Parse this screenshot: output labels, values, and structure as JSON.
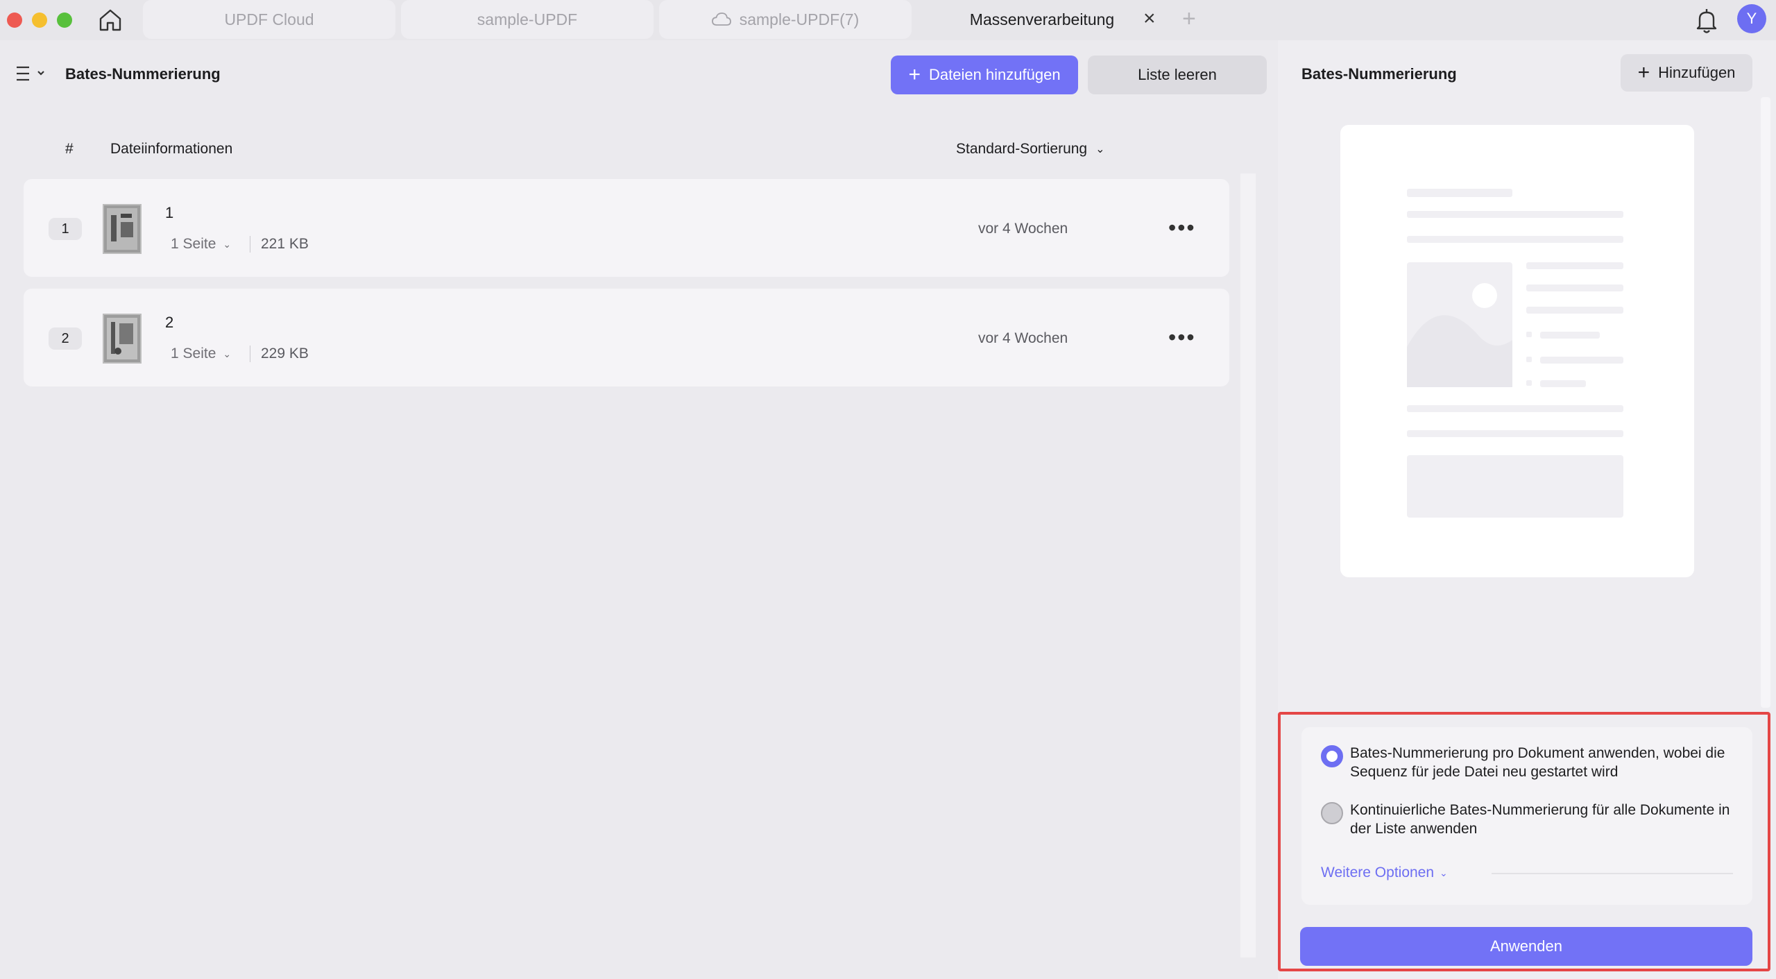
{
  "tabs": [
    {
      "label": "UPDF Cloud"
    },
    {
      "label": "sample-UPDF"
    },
    {
      "label": "sample-UPDF(7)"
    },
    {
      "label": "Massenverarbeitung"
    }
  ],
  "close_tab_symbol": "×",
  "new_tab_symbol": "+",
  "user": {
    "initial": "Y"
  },
  "left": {
    "title": "Bates-Nummerierung",
    "add_files_plus": "+",
    "add_files_label": "Dateien hinzufügen",
    "clear_list_label": "Liste leeren",
    "columns": {
      "hash": "#",
      "info": "Dateiinformationen"
    },
    "sort_label": "Standard-Sortierung",
    "files": [
      {
        "index": "1",
        "name": "1",
        "pages": "1 Seite",
        "size": "221 KB",
        "date": "vor 4 Wochen",
        "more": "•••"
      },
      {
        "index": "2",
        "name": "2",
        "pages": "1 Seite",
        "size": "229 KB",
        "date": "vor 4 Wochen",
        "more": "•••"
      }
    ]
  },
  "right": {
    "title": "Bates-Nummerierung",
    "add_plus": "+",
    "add_label": "Hinzufügen",
    "options": [
      {
        "text": "Bates-Nummerierung pro Dokument anwenden, wobei die Sequenz für jede Datei neu gestartet wird",
        "selected": true
      },
      {
        "text": "Kontinuierliche Bates-Nummerierung für alle Dokumente in der Liste anwenden",
        "selected": false
      }
    ],
    "more_options_label": "Weitere Optionen",
    "apply_label": "Anwenden"
  },
  "colors": {
    "accent": "#7272f6",
    "highlight": "#e44646"
  },
  "icons": [
    "home-icon",
    "cloud-icon",
    "bell-icon",
    "menu-icon",
    "chevron-down-icon",
    "plus-icon",
    "more-icon"
  ]
}
